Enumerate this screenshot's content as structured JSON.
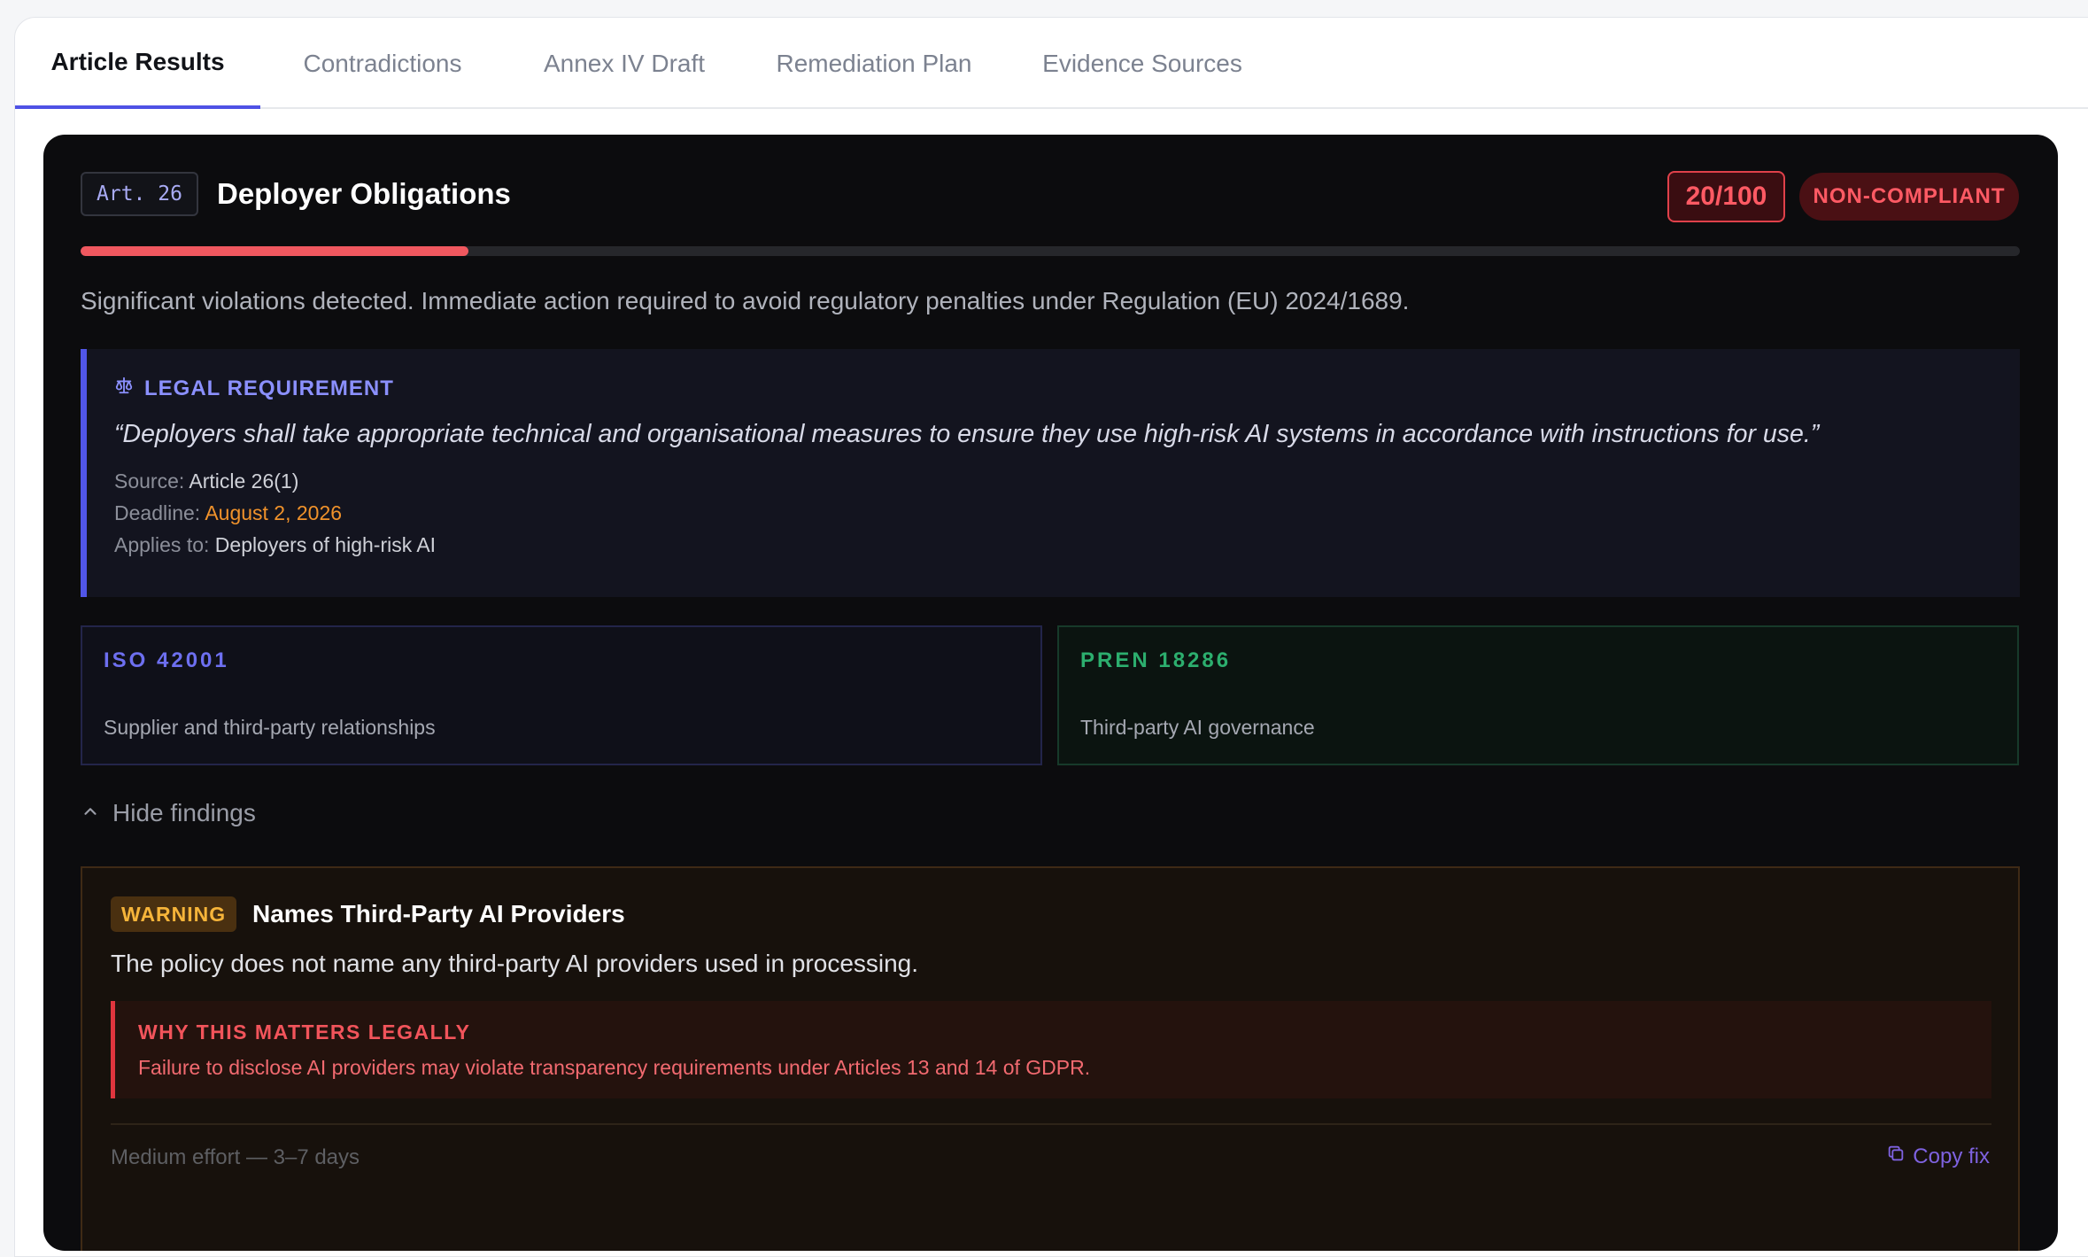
{
  "tabs": [
    {
      "label": "Article Results"
    },
    {
      "label": "Contradictions"
    },
    {
      "label": "Annex IV Draft"
    },
    {
      "label": "Remediation Plan"
    },
    {
      "label": "Evidence Sources"
    }
  ],
  "active_tab": "Article Results",
  "article": {
    "badge": "Art. 26",
    "title": "Deployer Obligations",
    "score": "20/100",
    "score_fraction": 0.2,
    "status": "NON-COMPLIANT",
    "summary": "Significant violations detected. Immediate action required to avoid regulatory penalties under Regulation (EU) 2024/1689."
  },
  "legal": {
    "icon": "scales-icon",
    "heading": "LEGAL REQUIREMENT",
    "quote": "“Deployers shall take appropriate technical and organisational measures to ensure they use high-risk AI systems in accordance with instructions for use.”",
    "source_label": "Source:",
    "source_value": "Article 26(1)",
    "deadline_label": "Deadline:",
    "deadline_value": "August 2, 2026",
    "applies_label": "Applies to:",
    "applies_value": "Deployers of high-risk AI"
  },
  "standards": [
    {
      "name": "ISO 42001",
      "desc": "Supplier and third-party relationships"
    },
    {
      "name": "PREN 18286",
      "desc": "Third-party AI governance"
    }
  ],
  "toggle_label": "Hide findings",
  "finding": {
    "severity": "WARNING",
    "title": "Names Third-Party AI Providers",
    "description": "The policy does not name any third-party AI providers used in processing.",
    "why_heading": "WHY THIS MATTERS LEGALLY",
    "why_text": "Failure to disclose AI providers may violate transparency requirements under Articles 13 and 14 of GDPR.",
    "effort": "Medium effort — 3–7 days",
    "copy_label": "Copy fix"
  },
  "colors": {
    "accent": "#4f52e5",
    "danger": "#ff5a64",
    "warning": "#f6b43a",
    "deadline": "#f0922b",
    "iso": "#6d6ff0",
    "pren": "#2cae6e"
  }
}
